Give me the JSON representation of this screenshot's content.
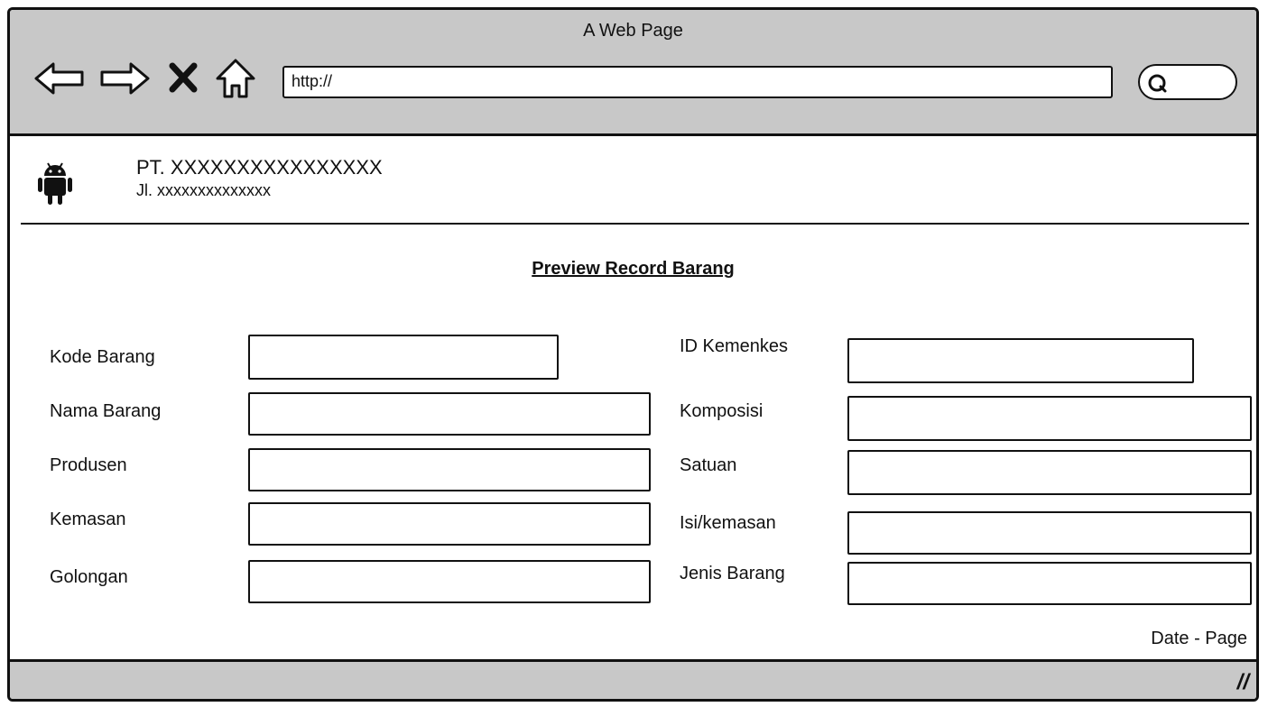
{
  "window": {
    "title": "A Web Page"
  },
  "address_bar": {
    "url": "http://"
  },
  "header": {
    "company_name": "PT. XXXXXXXXXXXXXXXX",
    "company_address": "Jl. xxxxxxxxxxxxxx"
  },
  "form": {
    "title": "Preview Record Barang",
    "left_fields": [
      {
        "label": "Kode Barang",
        "value": ""
      },
      {
        "label": "Nama Barang",
        "value": ""
      },
      {
        "label": "Produsen",
        "value": ""
      },
      {
        "label": "Kemasan",
        "value": ""
      },
      {
        "label": "Golongan",
        "value": ""
      }
    ],
    "right_fields": [
      {
        "label": "ID Kemenkes",
        "value": ""
      },
      {
        "label": "Komposisi",
        "value": ""
      },
      {
        "label": "Satuan",
        "value": ""
      },
      {
        "label": "Isi/kemasan",
        "value": ""
      },
      {
        "label": "Jenis Barang",
        "value": ""
      }
    ]
  },
  "footer": {
    "date_page": "Date - Page"
  },
  "icons": {
    "back": "back-arrow-icon",
    "forward": "forward-arrow-icon",
    "stop": "close-icon",
    "home": "home-icon",
    "search": "search-icon",
    "logo": "android-icon",
    "resize": "resize-grip-icon"
  }
}
